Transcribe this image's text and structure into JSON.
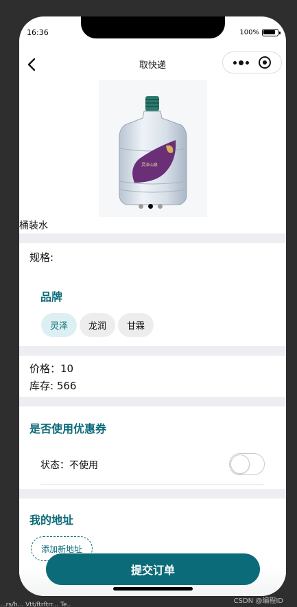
{
  "status_bar": {
    "time": "16:36",
    "battery": "100%"
  },
  "nav": {
    "title": "取快递"
  },
  "product": {
    "name": "桶装水",
    "label_text": "灵泽山泉",
    "carousel": {
      "count": 3,
      "active_index": 1
    }
  },
  "spec": {
    "label": "规格:",
    "brand_title": "品牌",
    "brands": [
      "灵泽",
      "龙润",
      "甘霖"
    ],
    "selected_brand_index": 0
  },
  "price": {
    "text": "价格：10"
  },
  "stock": {
    "text": "库存: 566"
  },
  "coupon": {
    "title": "是否使用优惠券",
    "status_text": "状态：不使用",
    "enabled": false
  },
  "address": {
    "title": "我的地址",
    "add_button": "添加新地址"
  },
  "submit": {
    "label": "提交订单"
  },
  "watermark": "CSDN @编程ID",
  "background_text": "...rs/h... Vtt/ftrftrr... Te..",
  "colors": {
    "accent": "#0b6b78",
    "chip_selected_bg": "#dcf0f3",
    "divider": "#eceef1"
  },
  "icons": {
    "back": "chevron-left-icon",
    "menu": "more-dots-icon",
    "close": "target-circle-icon"
  }
}
